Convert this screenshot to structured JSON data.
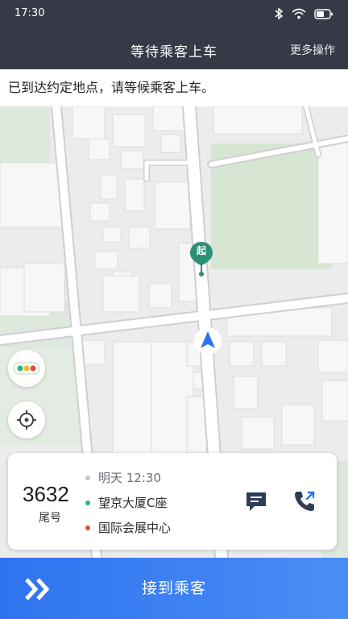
{
  "status": {
    "time": "17:30",
    "icons": [
      "bluetooth-icon",
      "wifi-icon",
      "battery-icon"
    ]
  },
  "header": {
    "title": "等待乘客上车",
    "more_label": "更多操作"
  },
  "notice": "已到达约定地点，请等候乘客上车。",
  "map": {
    "start_pin_label": "起",
    "controls": [
      "traffic-light-icon",
      "locate-icon"
    ]
  },
  "order": {
    "tail_number": "3632",
    "tail_label": "尾号",
    "time": "明天 12:30",
    "pickup": "望京大厦C座",
    "dropoff": "国际会展中心",
    "actions": [
      "message-icon",
      "phone-icon"
    ]
  },
  "bottom": {
    "label": "接到乘客",
    "icon": "double-chevron-right-icon"
  },
  "colors": {
    "header": "#353a46",
    "accent": "#3a7ff2",
    "pickup_dot": "#2bb673",
    "dropoff_dot": "#e04a3a",
    "time_dot": "#bfc3c9",
    "pin": "#2e8f77"
  }
}
